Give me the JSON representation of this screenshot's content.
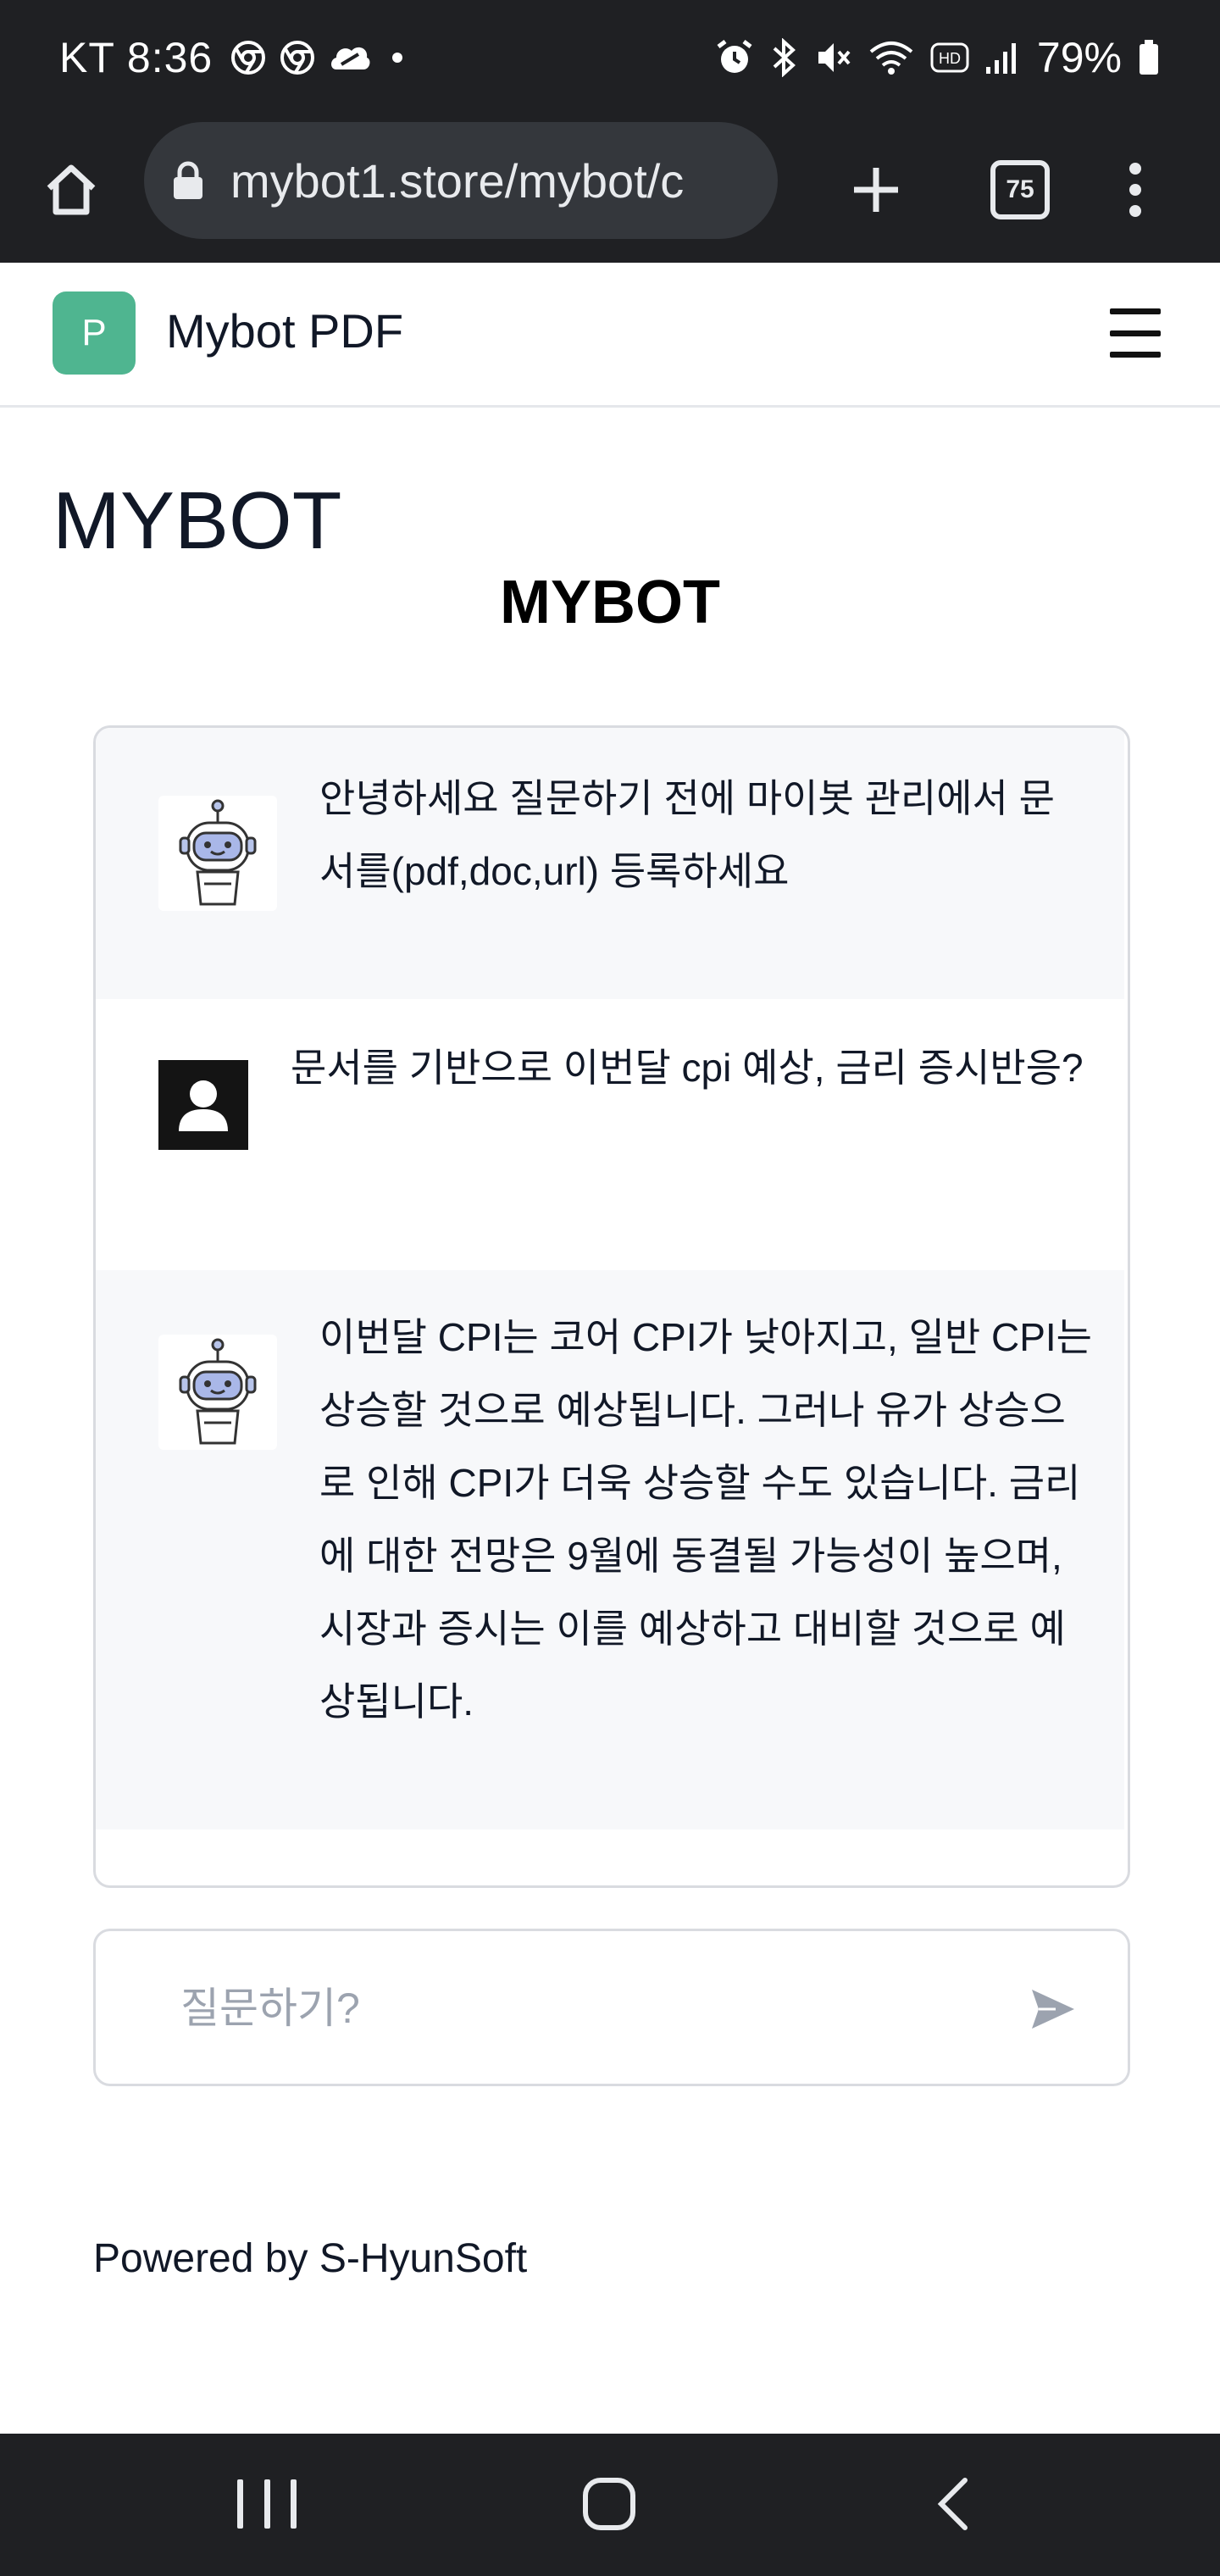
{
  "status_bar": {
    "carrier_time": "KT 8:36",
    "battery": "79%",
    "icons": [
      "chrome-icon",
      "chrome-icon",
      "cloud-icon",
      "dot-icon",
      "alarm-icon",
      "bluetooth-icon",
      "mute-icon",
      "wifi-icon",
      "hd-icon",
      "signal-icon",
      "battery-icon"
    ]
  },
  "browser": {
    "url": "mybot1.store/mybot/c",
    "tab_count": "75"
  },
  "header": {
    "logo_letter": "P",
    "title": "Mybot PDF"
  },
  "page": {
    "heading": "MYBOT",
    "subheading": "MYBOT"
  },
  "chat": {
    "messages": [
      {
        "role": "bot",
        "text": "안녕하세요 질문하기 전에 마이봇 관리에서 문서를(pdf,doc,url) 등록하세요"
      },
      {
        "role": "user",
        "text": "문서를 기반으로 이번달 cpi 예상, 금리 증시반응?"
      },
      {
        "role": "bot",
        "text": "이번달 CPI는 코어 CPI가 낮아지고, 일반 CPI는 상승할 것으로 예상됩니다. 그러나 유가 상승으로 인해 CPI가 더욱 상승할 수도 있습니다. 금리에 대한 전망은 9월에 동결될 가능성이 높으며, 시장과 증시는 이를 예상하고 대비할 것으로 예상됩니다."
      }
    ]
  },
  "input": {
    "placeholder": "질문하기?",
    "value": ""
  },
  "footer": {
    "text": "Powered by S-HyunSoft"
  },
  "colors": {
    "logo_green": "#4fb590",
    "system_bar": "#1f2023",
    "bot_message_bg": "#f7f8fa"
  }
}
